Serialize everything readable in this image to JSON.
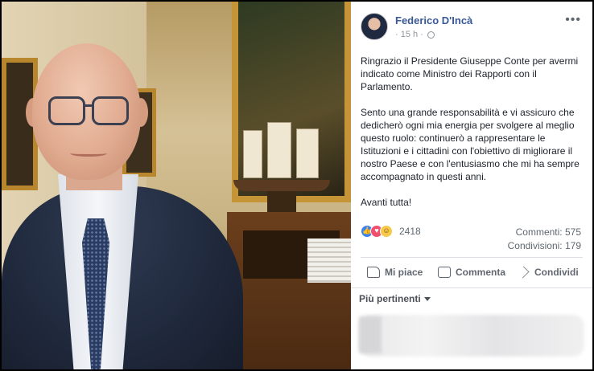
{
  "post": {
    "author": "Federico D'Incà",
    "time": "15 h",
    "more": "•••",
    "paragraphs": [
      "Ringrazio il Presidente Giuseppe Conte per avermi indicato come Ministro dei Rapporti con il Parlamento.",
      "Sento una grande responsabilità e vi assicuro che dedicherò ogni mia energia per svolgere al meglio questo ruolo: continuerò a rappresentare le Istituzioni e i cittadini con l'obiettivo di migliorare il nostro Paese e con l'entusiasmo che mi ha sempre accompagnato in questi anni.",
      "Avanti tutta!"
    ],
    "reaction_count": "2418",
    "comments": "Commenti: 575",
    "shares": "Condivisioni: 179",
    "actions": {
      "like": "Mi piace",
      "comment": "Commenta",
      "share": "Condividi"
    },
    "sort_label": "Più pertinenti",
    "icons": [
      "globe-icon",
      "like-reaction-icon",
      "love-reaction-icon",
      "haha-reaction-icon",
      "thumbs-up-icon",
      "comment-icon",
      "share-icon",
      "caret-down-icon"
    ],
    "colors": {
      "author": "#385898",
      "like": "#3b82f6",
      "love": "#f0506e",
      "haha": "#f7c94b"
    }
  }
}
